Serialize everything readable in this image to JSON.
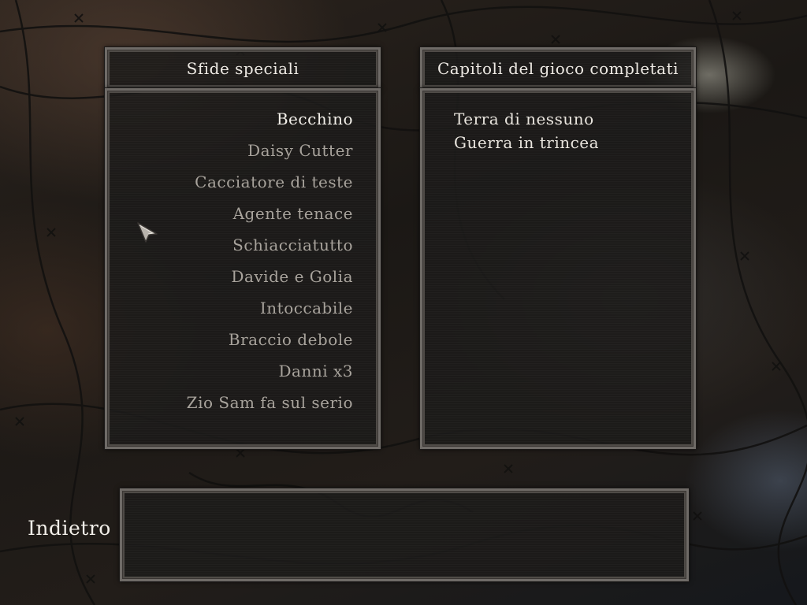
{
  "challenges_panel": {
    "title": "Sfide speciali",
    "items": [
      {
        "label": "Becchino",
        "selected": true
      },
      {
        "label": "Daisy Cutter",
        "selected": false
      },
      {
        "label": "Cacciatore di teste",
        "selected": false
      },
      {
        "label": "Agente tenace",
        "selected": false
      },
      {
        "label": "Schiacciatutto",
        "selected": false
      },
      {
        "label": "Davide e Golia",
        "selected": false
      },
      {
        "label": "Intoccabile",
        "selected": false
      },
      {
        "label": "Braccio debole",
        "selected": false
      },
      {
        "label": "Danni x3",
        "selected": false
      },
      {
        "label": "Zio Sam fa sul serio",
        "selected": false
      }
    ]
  },
  "chapters_panel": {
    "title": "Capitoli del gioco completati",
    "items": [
      {
        "label": "Terra di nessuno"
      },
      {
        "label": "Guerra in trincea"
      }
    ]
  },
  "description_box": {
    "text": ""
  },
  "back_button": {
    "label": "Indietro"
  },
  "colors": {
    "selected_text": "#f3f0ea",
    "unselected_text": "#a8a39c",
    "panel_border": "#6f6b67"
  },
  "icons": {
    "cursor": "arrow-cursor-icon",
    "background": "barbed-wire"
  }
}
